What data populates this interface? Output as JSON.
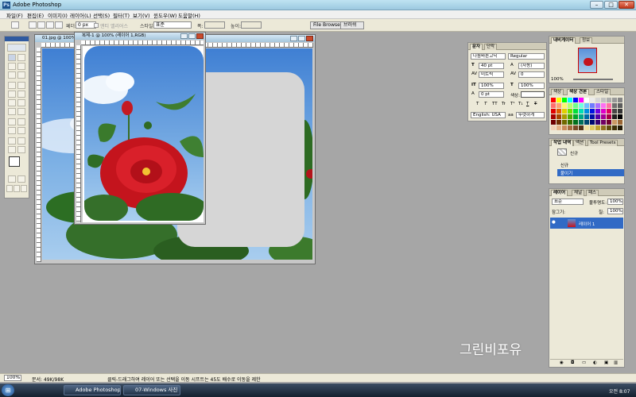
{
  "window": {
    "title": "Adobe Photoshop",
    "app_icon_text": "Ps"
  },
  "window_controls": {
    "minimize": "–",
    "maximize": "□",
    "close": "✕"
  },
  "menu": [
    {
      "label": "파일(F)"
    },
    {
      "label": "편집(E)"
    },
    {
      "label": "이미지(I)"
    },
    {
      "label": "레이어(L)"
    },
    {
      "label": "선택(S)"
    },
    {
      "label": "필터(T)"
    },
    {
      "label": "보기(V)"
    },
    {
      "label": "윈도우(W)"
    },
    {
      "label": "도움말(H)"
    }
  ],
  "options_bar": {
    "feather_label": "페더:",
    "feather_value": "0 px",
    "antialias_label": "앤티 앨리어스",
    "style_label": "스타일:",
    "style_value": "표준",
    "width_label": "폭:",
    "height_label": "높이:",
    "tab_file_browser": "File Browser",
    "tab_brushes": "브러쉬"
  },
  "documents": [
    {
      "title": "01.jpg @ 100% (RGB)"
    },
    {
      "title": "복제-1 @ 100% (레이어 1,RGB)"
    }
  ],
  "character_panel": {
    "tabs": [
      "문자",
      "단락"
    ],
    "font_family": "나눔바른고딕",
    "font_style": "Regular",
    "size": "40 pt",
    "leading": "(자동)",
    "kerning": "미트릭",
    "tracking": "0",
    "vscale": "100%",
    "hscale": "100%",
    "baseline": "0 pt",
    "color_label": "색상:",
    "style_buttons": [
      "T",
      "T",
      "TT",
      "Tr",
      "T¹",
      "T₁",
      "T",
      "T"
    ],
    "language": "English: USA",
    "antialias": "강하게",
    "aa_prefix": "aa",
    "antialias_alt": "뚜렷하게"
  },
  "navigator_panel": {
    "tabs": [
      "내비게이터",
      "정보"
    ],
    "zoom": "100%"
  },
  "swatches_panel": {
    "tabs": [
      "색상",
      "색상 견본",
      "스타일"
    ]
  },
  "swatch_colors": [
    "#ff0000",
    "#ffff00",
    "#00ff00",
    "#00ffff",
    "#0000ff",
    "#ff00ff",
    "#ffffff",
    "#ebebeb",
    "#d6d6d6",
    "#c2c2c2",
    "#adadad",
    "#999999",
    "#858585",
    "#ff6f6f",
    "#ffa36f",
    "#fff56f",
    "#b6ff6f",
    "#6fff8a",
    "#6fffe3",
    "#6fc1ff",
    "#6f7bff",
    "#a96fff",
    "#ff6ff2",
    "#ff6fa3",
    "#707070",
    "#5c5c5c",
    "#e00000",
    "#e05a00",
    "#e0d000",
    "#6ee000",
    "#00e03a",
    "#00e0b5",
    "#0090e0",
    "#0012e0",
    "#6e00e0",
    "#e000c9",
    "#e00060",
    "#474747",
    "#333333",
    "#a80000",
    "#a84400",
    "#a89c00",
    "#52a800",
    "#00a82c",
    "#00a888",
    "#006ca8",
    "#000da8",
    "#5200a8",
    "#a80097",
    "#a80048",
    "#1f1f1f",
    "#000000",
    "#700000",
    "#702d00",
    "#706800",
    "#377000",
    "#00701d",
    "#00705b",
    "#004870",
    "#000970",
    "#370070",
    "#700064",
    "#700030",
    "#cc9966",
    "#996633",
    "#f2d2b8",
    "#e6b48a",
    "#c98a5a",
    "#a66b3f",
    "#7a4a26",
    "#543218",
    "#f0e0a0",
    "#e0c860",
    "#c0a030",
    "#907020",
    "#605010",
    "#403008",
    "#201804"
  ],
  "history_panel": {
    "tabs": [
      "작업 내역",
      "액션",
      "Tool Presets"
    ],
    "snapshot": "신규",
    "items": [
      {
        "label": "신규"
      },
      {
        "label": "붙이기"
      }
    ]
  },
  "layers_panel": {
    "tabs": [
      "레이어",
      "채널",
      "패스"
    ],
    "blend_mode": "표준",
    "opacity_label": "불투명도:",
    "opacity": "100%",
    "lock_label": "잠그기:",
    "fill_label": "칠:",
    "fill": "100%",
    "layer_name": "레이어 1"
  },
  "status": {
    "zoom": "100%",
    "doc_info": "문서: 49K/98K",
    "hint": "클릭-드래그하여 레이어 또는 선택을 이동 시프트는 45도 배수로 이동을 제한"
  },
  "taskbar": {
    "start": "⊞",
    "items": [
      {
        "label": "Adobe Photoshop"
      },
      {
        "label": "07-Windows 사진 ..."
      }
    ],
    "clock": "오전 8:07"
  },
  "watermark": "그린비포유"
}
